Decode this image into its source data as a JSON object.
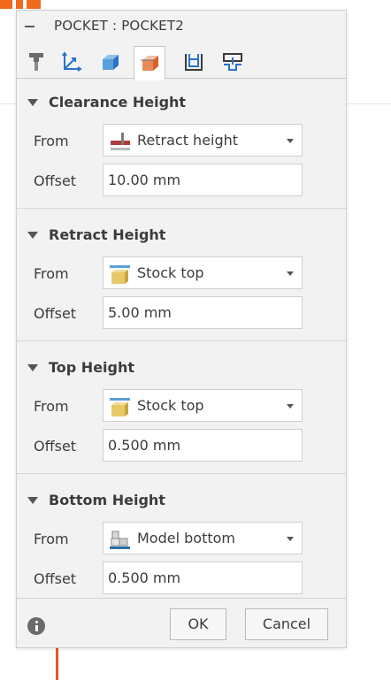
{
  "dialog": {
    "title": "POCKET : POCKET2",
    "tabs": [
      {
        "name": "tool-tab",
        "icon": "tool-icon"
      },
      {
        "name": "geometry-tab",
        "icon": "axis-icon"
      },
      {
        "name": "stock-tab",
        "icon": "stock-cube-icon"
      },
      {
        "name": "heights-tab",
        "icon": "heights-box-icon",
        "active": true
      },
      {
        "name": "passes-tab",
        "icon": "passes-icon"
      },
      {
        "name": "linking-tab",
        "icon": "linking-icon"
      }
    ]
  },
  "sections": {
    "clearance": {
      "title": "Clearance Height",
      "from_label": "From",
      "from_value": "Retract height",
      "offset_label": "Offset",
      "offset_value": "10.00 mm"
    },
    "retract": {
      "title": "Retract Height",
      "from_label": "From",
      "from_value": "Stock top",
      "offset_label": "Offset",
      "offset_value": "5.00 mm"
    },
    "top": {
      "title": "Top Height",
      "from_label": "From",
      "from_value": "Stock top",
      "offset_label": "Offset",
      "offset_value": "0.500 mm"
    },
    "bottom": {
      "title": "Bottom Height",
      "from_label": "From",
      "from_value": "Model bottom",
      "offset_label": "Offset",
      "offset_value": "0.500 mm"
    }
  },
  "footer": {
    "ok_label": "OK",
    "cancel_label": "Cancel"
  },
  "colors": {
    "accent_orange": "#f26a1b",
    "stock_yellow": "#e8c96a",
    "stock_line_blue": "#5aa0d8",
    "retract_red": "#b03a3a"
  }
}
